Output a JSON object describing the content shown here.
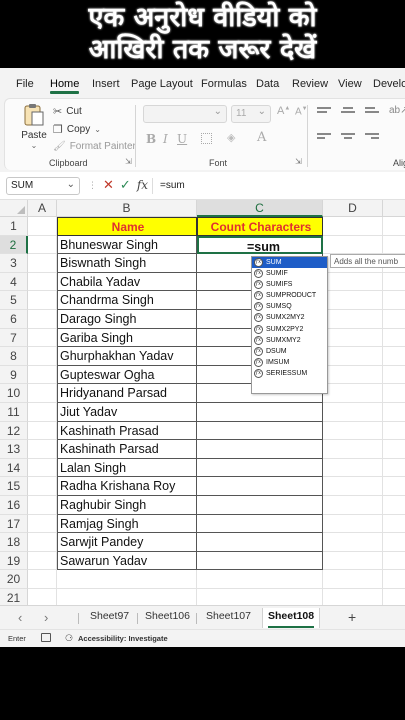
{
  "banner": {
    "line1": "एक अनुरोध वीडियो को",
    "line2": "आखिरी तक जरूर देखें"
  },
  "ribbon": {
    "tabs": [
      "File",
      "Home",
      "Insert",
      "Page Layout",
      "Formulas",
      "Data",
      "Review",
      "View",
      "Develo"
    ],
    "active_tab": "Home",
    "clipboard": {
      "paste": "Paste",
      "cut": "Cut",
      "copy": "Copy",
      "format_painter": "Format Painter",
      "label": "Clipboard"
    },
    "font": {
      "size": "11",
      "label": "Font"
    },
    "alignment_label": "Alig"
  },
  "formula_bar": {
    "name_box": "SUM",
    "fx": "fx",
    "value": "=sum"
  },
  "grid": {
    "columns": [
      "A",
      "B",
      "C",
      "D"
    ],
    "rows": [
      "1",
      "2",
      "3",
      "4",
      "5",
      "6",
      "7",
      "8",
      "9",
      "10",
      "11",
      "12",
      "13",
      "14",
      "15",
      "16",
      "17",
      "18",
      "19",
      "20",
      "21"
    ],
    "selected_column": "C",
    "selected_row": "2",
    "header_name": "Name",
    "header_count": "Count Characters",
    "active_cell_text": "=sum",
    "names": [
      "Bhuneswar Singh",
      "Biswnath Singh",
      "Chabila Yadav",
      "Chandrma Singh",
      "Darago Singh",
      "Gariba Singh",
      "Ghurphakhan Yadav",
      "Gupteswar Ogha",
      "Hridyanand Parsad",
      "Jiut Yadav",
      "Kashinath  Prasad",
      "Kashinath Parsad",
      "Lalan Singh",
      "Radha Krishana Roy",
      "Raghubir Singh",
      "Ramjag Singh",
      "Sarwjit Pandey",
      "Sawarun Yadav"
    ],
    "header_fill": "#ffff00",
    "header_text_color": "#e03030"
  },
  "autocomplete": {
    "items": [
      "SUM",
      "SUMIF",
      "SUMIFS",
      "SUMPRODUCT",
      "SUMSQ",
      "SUMX2MY2",
      "SUMX2PY2",
      "SUMXMY2",
      "DSUM",
      "IMSUM",
      "SERIESSUM"
    ],
    "selected_index": 0,
    "tooltip": "Adds all the numb"
  },
  "sheets": {
    "tabs": [
      "Sheet97",
      "Sheet106",
      "Sheet107",
      "Sheet108"
    ],
    "active": "Sheet108",
    "add": "+"
  },
  "status": {
    "mode": "Enter",
    "accessibility": "Accessibility: Investigate"
  },
  "accent_color": "#1e7145"
}
